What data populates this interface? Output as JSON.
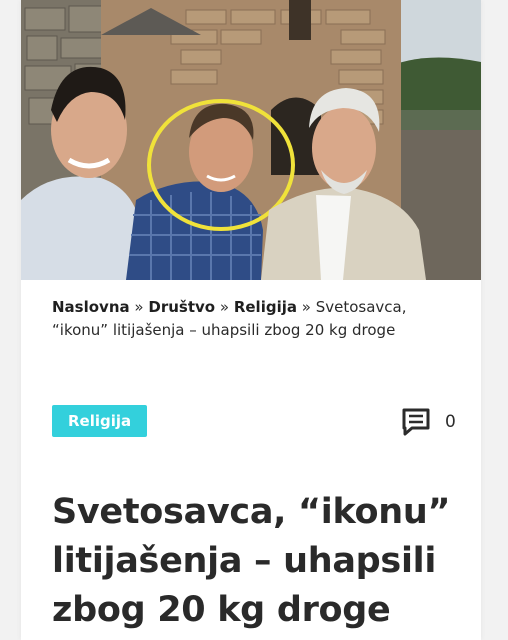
{
  "hero_image": {
    "alt": ""
  },
  "breadcrumb": {
    "home": "Naslovna",
    "section": "Društvo",
    "category": "Religija",
    "current": "Svetosavca, “ikonu” litijašenja – uhapsili zbog 20 kg droge",
    "separator": "»"
  },
  "category_badge": {
    "label": "Religija",
    "color": "#33d0dc"
  },
  "comments": {
    "icon": "comment-icon",
    "count": "0"
  },
  "article": {
    "title": "Svetosavca, “ikonu” litijašenja – uhapsili zbog 20 kg droge"
  }
}
